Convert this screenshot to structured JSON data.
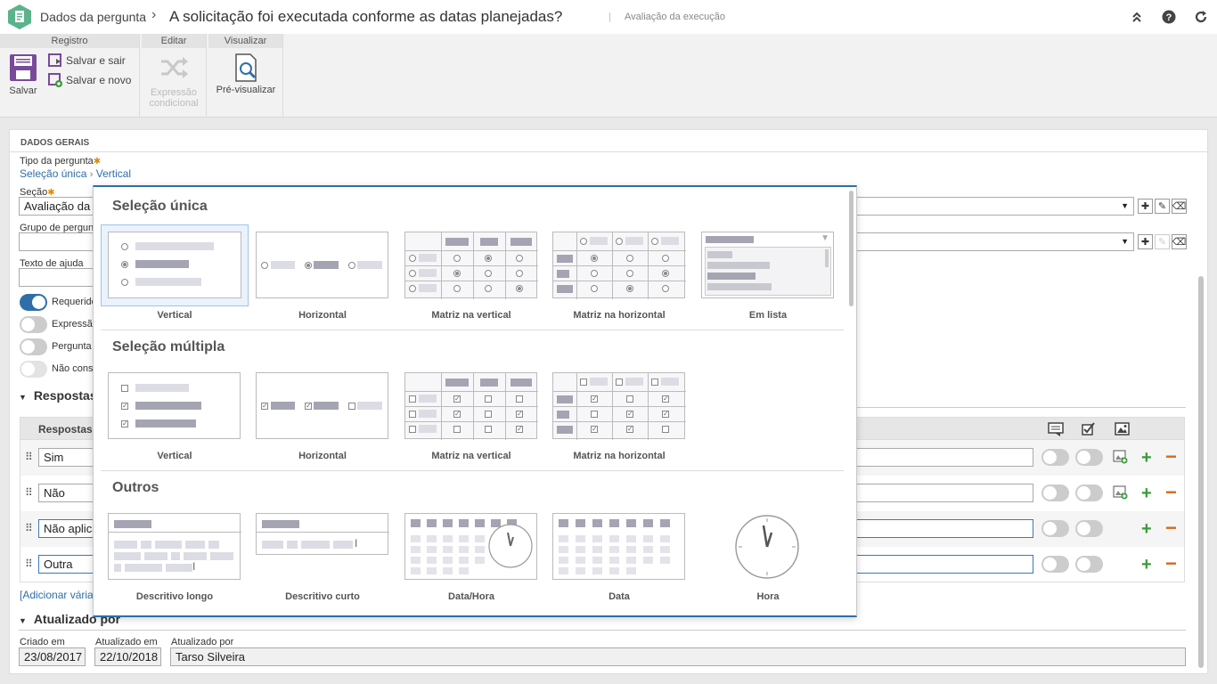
{
  "header": {
    "title": "Dados da pergunta",
    "chevron": "›",
    "question": "A solicitação foi executada conforme as datas planejadas?",
    "separator": "|",
    "subtitle": "Avaliação da execução"
  },
  "toolbar": {
    "groups": {
      "registro": "Registro",
      "editar": "Editar",
      "visualizar": "Visualizar"
    },
    "salvar": "Salvar",
    "salvar_sair": "Salvar e sair",
    "salvar_novo": "Salvar e novo",
    "expressao": "Expressão",
    "condicional": "condicional",
    "previsualizar": "Pré-visualizar"
  },
  "form": {
    "section_title": "DADOS GERAIS",
    "tipo_label": "Tipo da pergunta",
    "tipo_link1": "Seleção única",
    "tipo_sep": "›",
    "tipo_link2": "Vertical",
    "secao_label": "Seção",
    "secao_value": "Avaliação da",
    "grupo_label": "Grupo de pergun",
    "ajuda_label": "Texto de ajuda",
    "toggles": [
      "Requerido",
      "Expressã",
      "Pergunta",
      "Não cons"
    ],
    "respostas_head": "Respostas",
    "respostas_col": "Respostas",
    "answers": [
      "Sim",
      "Não",
      "Não aplica",
      "Outra"
    ],
    "adicionar": "[Adicionar vária",
    "atualizado_head": "Atualizado por",
    "criado_em_label": "Criado em",
    "criado_em": "23/08/2017",
    "atualizado_em_label": "Atualizado em",
    "atualizado_em": "22/10/2018",
    "atualizado_por_label": "Atualizado por",
    "atualizado_por": "Tarso Silveira"
  },
  "popup": {
    "sections": [
      {
        "title": "Seleção única",
        "items": [
          "Vertical",
          "Horizontal",
          "Matriz na vertical",
          "Matriz na horizontal",
          "Em lista"
        ]
      },
      {
        "title": "Seleção múltipla",
        "items": [
          "Vertical",
          "Horizontal",
          "Matriz na vertical",
          "Matriz na horizontal"
        ]
      },
      {
        "title": "Outros",
        "items": [
          "Descritivo longo",
          "Descritivo curto",
          "Data/Hora",
          "Data",
          "Hora"
        ]
      }
    ],
    "selected": "Vertical"
  },
  "colors": {
    "accent": "#2f6ea8",
    "add": "#3a9b3a",
    "remove": "#d2691e"
  }
}
